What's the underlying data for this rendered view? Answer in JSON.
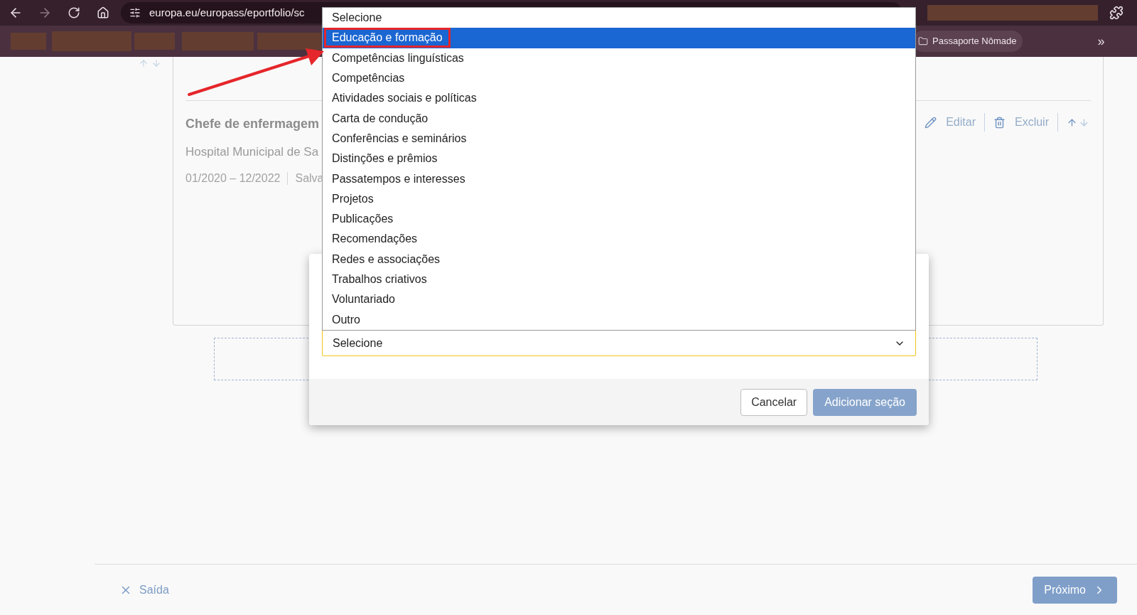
{
  "browser": {
    "url": "europa.eu/europass/eportfolio/sc",
    "bookmark": "Passaporte Nômade",
    "overflow": "»"
  },
  "entry": {
    "title": "Chefe de enfermagem",
    "employer": "Hospital Municipal de Sa",
    "dates": "01/2020 – 12/2022",
    "status": "Salva",
    "actions": [
      {
        "kind": "edit",
        "label": "Editar"
      },
      {
        "kind": "delete",
        "label": "Excluir"
      }
    ]
  },
  "dropdown": {
    "value": "Selecione",
    "options": [
      {
        "label": "Selecione",
        "highlighted": false,
        "annotated": false
      },
      {
        "label": "Educação e formação",
        "highlighted": true,
        "annotated": true
      },
      {
        "label": "Competências linguísticas",
        "highlighted": false,
        "annotated": false
      },
      {
        "label": "Competências",
        "highlighted": false,
        "annotated": false
      },
      {
        "label": "Atividades sociais e políticas",
        "highlighted": false,
        "annotated": false
      },
      {
        "label": "Carta de condução",
        "highlighted": false,
        "annotated": false
      },
      {
        "label": "Conferências e seminários",
        "highlighted": false,
        "annotated": false
      },
      {
        "label": "Distinções e prêmios",
        "highlighted": false,
        "annotated": false
      },
      {
        "label": "Passatempos e interesses",
        "highlighted": false,
        "annotated": false
      },
      {
        "label": "Projetos",
        "highlighted": false,
        "annotated": false
      },
      {
        "label": "Publicações",
        "highlighted": false,
        "annotated": false
      },
      {
        "label": "Recomendações",
        "highlighted": false,
        "annotated": false
      },
      {
        "label": "Redes e associações",
        "highlighted": false,
        "annotated": false
      },
      {
        "label": "Trabalhos criativos",
        "highlighted": false,
        "annotated": false
      },
      {
        "label": "Voluntariado",
        "highlighted": false,
        "annotated": false
      },
      {
        "label": "Outro",
        "highlighted": false,
        "annotated": false
      }
    ]
  },
  "modal": {
    "cancel": "Cancelar",
    "submit": {
      "label": "Adicionar seção",
      "disabled": true
    }
  },
  "footer": {
    "exit": "Saída",
    "next": "Próximo"
  }
}
